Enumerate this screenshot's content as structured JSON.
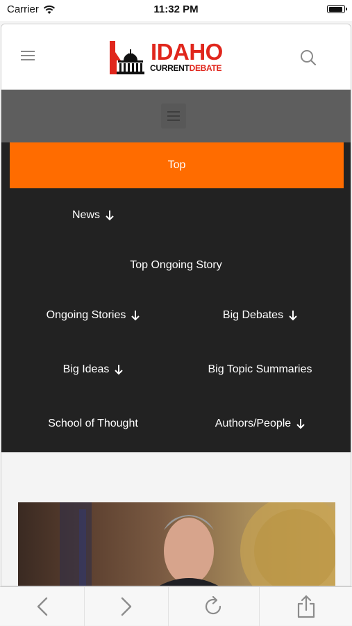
{
  "status_bar": {
    "carrier": "Carrier",
    "time": "11:32 PM"
  },
  "header": {
    "logo": {
      "title": "IDAHO",
      "sub_current": "CURRENT",
      "sub_debate": "DEBATE"
    }
  },
  "menu": {
    "active_item": "Top",
    "rows": [
      [
        "News"
      ],
      [
        "Top Ongoing Story"
      ],
      [
        "Ongoing Stories",
        "Big Debates"
      ],
      [
        "Big Ideas",
        "Big Topic Summaries"
      ],
      [
        "School of Thought",
        "Authors/People"
      ]
    ],
    "items": {
      "news": "News",
      "top_ongoing_story": "Top Ongoing Story",
      "ongoing_stories": "Ongoing Stories",
      "big_debates": "Big Debates",
      "big_ideas": "Big Ideas",
      "big_topic_summaries": "Big Topic Summaries",
      "school_of_thought": "School of Thought",
      "authors_people": "Authors/People"
    }
  },
  "toolbar": {
    "icons": [
      "back-icon",
      "forward-icon",
      "reload-icon",
      "share-icon"
    ]
  },
  "colors": {
    "accent": "#ff6c00",
    "menu_bg": "#222222",
    "brand_red": "#e0261c"
  }
}
